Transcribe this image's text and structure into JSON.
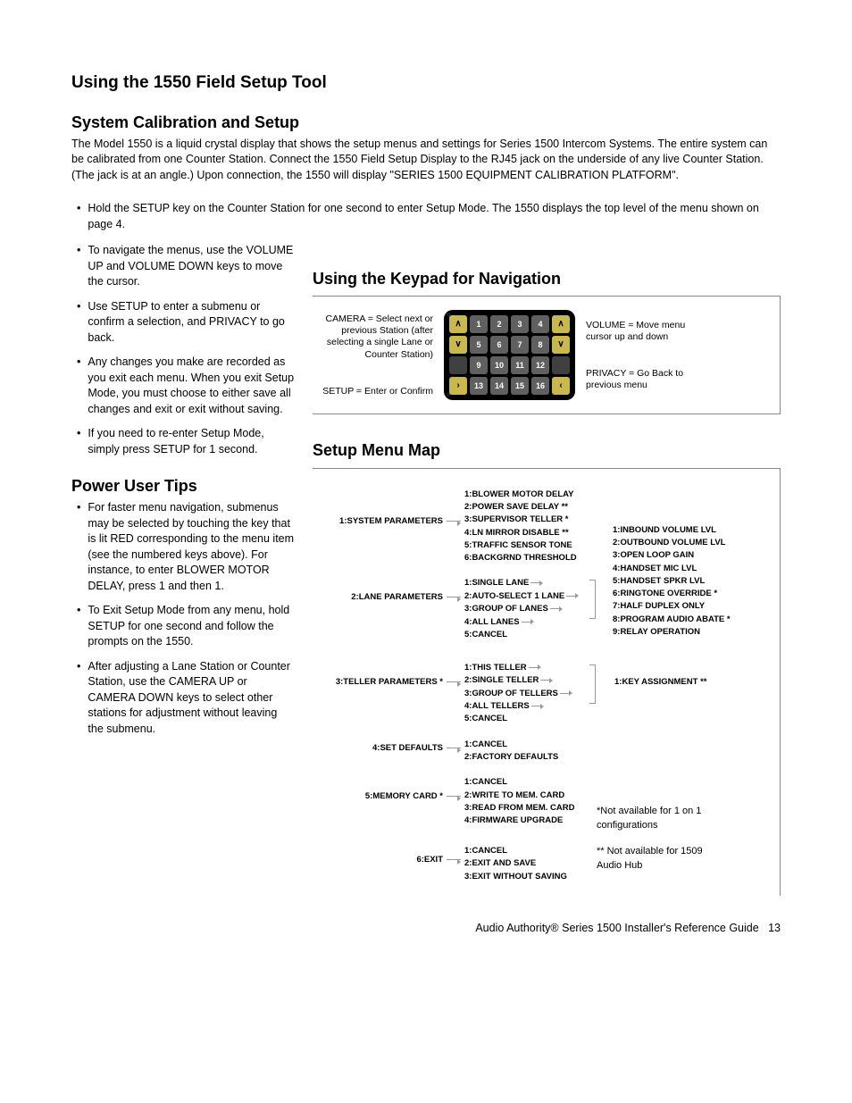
{
  "headings": {
    "main": "Using the 1550 Field Setup Tool",
    "sub1": "System Calibration and Setup",
    "keypad": "Using the Keypad for Navigation",
    "power": "Power User Tips",
    "menumap": "Setup Menu Map"
  },
  "intro": "The Model 1550 is a liquid crystal display that shows the setup menus and settings for Series 1500 Intercom Systems. The entire system can be calibrated from one Counter Station. Connect the 1550 Field Setup Display to the RJ45 jack on the underside of any live Counter Station. (The jack is at an angle.) Upon connection, the 1550 will display \"SERIES 1500 EQUIPMENT CALIBRATION PLATFORM\".",
  "top_bullet": "Hold the SETUP key on the Counter Station for one second to enter Setup Mode. The 1550 displays the top level of the menu shown on page 4.",
  "nav_bullets": [
    "To navigate the menus, use the VOLUME UP and VOLUME DOWN keys to move the cursor.",
    "Use SETUP to enter a submenu or confirm a selection, and PRIVACY to go back.",
    "Any changes you make are recorded as you exit each menu. When you exit Setup Mode, you must choose to either save all changes and exit or exit without saving.",
    "If you need to re-enter Setup Mode, simply press SETUP for 1 second."
  ],
  "power_bullets": [
    "For faster menu navigation, submenus may be selected by touching the key that is lit RED corresponding to the menu item (see the numbered keys above). For instance, to enter BLOWER MOTOR DELAY, press 1 and then 1.",
    "To Exit Setup Mode from any menu, hold SETUP for one second and follow the prompts on the 1550.",
    "After adjusting a Lane Station or Counter Station, use the CAMERA UP or CAMERA DOWN keys to select other stations for adjustment without leaving the submenu."
  ],
  "keypad_labels": {
    "camera": "CAMERA = Select next or previous Station (after selecting a single Lane or Counter Station)",
    "setup": "SETUP = Enter or Confirm",
    "volume": "VOLUME = Move menu cursor up and down",
    "privacy": "PRIVACY = Go Back to previous menu"
  },
  "keypad_buttons": [
    "1",
    "2",
    "3",
    "4",
    "5",
    "6",
    "7",
    "8",
    "9",
    "10",
    "11",
    "12",
    "13",
    "14",
    "15",
    "16"
  ],
  "menu_map": {
    "r1": {
      "label": "1:SYSTEM PARAMETERS",
      "sub": [
        "1:BLOWER MOTOR DELAY",
        "2:POWER SAVE DELAY **",
        "3:SUPERVISOR TELLER *",
        "4:LN MIRROR DISABLE **",
        "5:TRAFFIC SENSOR TONE",
        "6:BACKGRND THRESHOLD"
      ]
    },
    "r2": {
      "label": "2:LANE PARAMETERS",
      "sub": [
        "1:SINGLE LANE",
        "2:AUTO-SELECT 1 LANE",
        "3:GROUP OF LANES",
        "4:ALL LANES",
        "5:CANCEL"
      ],
      "detail": [
        "1:INBOUND VOLUME LVL",
        "2:OUTBOUND VOLUME LVL",
        "3:OPEN LOOP GAIN",
        "4:HANDSET MIC LVL",
        "5:HANDSET SPKR LVL",
        "6:RINGTONE OVERRIDE *",
        "7:HALF DUPLEX ONLY",
        "8:PROGRAM AUDIO ABATE *",
        "9:RELAY OPERATION"
      ]
    },
    "r3": {
      "label": "3:TELLER PARAMETERS *",
      "sub": [
        "1:THIS TELLER",
        "2:SINGLE TELLER",
        "3:GROUP OF TELLERS",
        "4:ALL TELLERS",
        "5:CANCEL"
      ],
      "detail": [
        "1:KEY ASSIGNMENT **"
      ]
    },
    "r4": {
      "label": "4:SET DEFAULTS",
      "sub": [
        "1:CANCEL",
        "2:FACTORY DEFAULTS"
      ]
    },
    "r5": {
      "label": "5:MEMORY CARD *",
      "sub": [
        "1:CANCEL",
        "2:WRITE TO MEM. CARD",
        "3:READ FROM MEM. CARD",
        "4:FIRMWARE UPGRADE"
      ]
    },
    "r6": {
      "label": "6:EXIT",
      "sub": [
        "1:CANCEL",
        "2:EXIT AND SAVE",
        "3:EXIT WITHOUT SAVING"
      ]
    }
  },
  "footnotes": {
    "n1": "*Not available for 1 on 1 configurations",
    "n2": "** Not available for 1509 Audio Hub"
  },
  "footer": {
    "text": "Audio Authority® Series 1500 Installer's Reference Guide",
    "page": "13"
  }
}
